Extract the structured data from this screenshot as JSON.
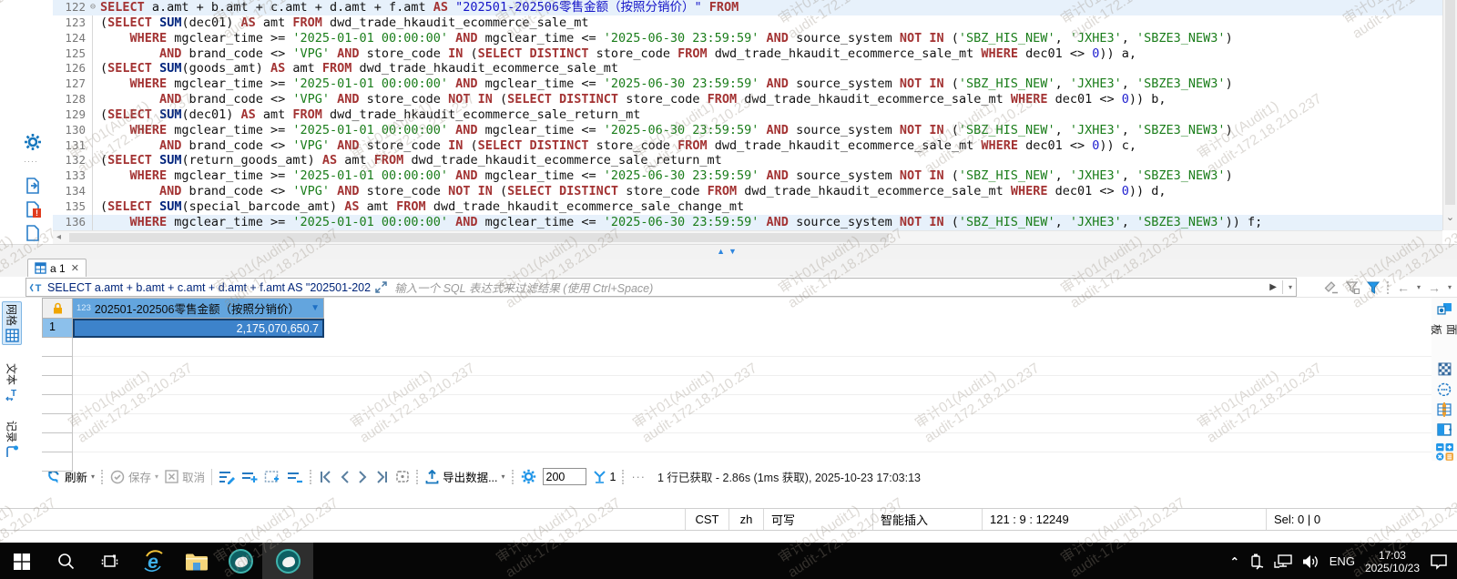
{
  "watermark": {
    "line1": "审计01(Audit1)",
    "line2": "audit-172.18.210.237"
  },
  "icons": {
    "caret_down": "▾",
    "close": "✕",
    "left_arrow": "◂",
    "down_arrow": "⌄",
    "sash_up": "▲",
    "sash_down": "▼",
    "fold_collapse": "⊖",
    "overflow": "···",
    "play": "▶",
    "back": "←",
    "forward": "→",
    "sort_down": "▼"
  },
  "editor": {
    "lines": [
      {
        "no": "122",
        "fold": "⊖",
        "hl": true,
        "t": [
          [
            "k",
            "SELECT"
          ],
          [
            "p",
            " a.amt + b.amt + c.amt + d.amt + f.amt "
          ],
          [
            "k",
            "AS"
          ],
          [
            "p",
            " "
          ],
          [
            "q",
            "\"202501-202506零售金额（按照分销价）\""
          ],
          [
            "p",
            " "
          ],
          [
            "k",
            "FROM"
          ]
        ]
      },
      {
        "no": "123",
        "scope": true,
        "t": [
          [
            "p",
            "("
          ],
          [
            "k",
            "SELECT"
          ],
          [
            "p",
            " "
          ],
          [
            "f",
            "SUM"
          ],
          [
            "p",
            "(dec01) "
          ],
          [
            "k",
            "AS"
          ],
          [
            "p",
            " amt "
          ],
          [
            "k",
            "FROM"
          ],
          [
            "p",
            " dwd_trade_hkaudit_ecommerce_sale_mt"
          ]
        ]
      },
      {
        "no": "124",
        "scope": true,
        "t": [
          [
            "p",
            "    "
          ],
          [
            "k",
            "WHERE"
          ],
          [
            "p",
            " mgclear_time >= "
          ],
          [
            "s",
            "'2025-01-01 00:00:00'"
          ],
          [
            "p",
            " "
          ],
          [
            "k",
            "AND"
          ],
          [
            "p",
            " mgclear_time <= "
          ],
          [
            "s",
            "'2025-06-30 23:59:59'"
          ],
          [
            "p",
            " "
          ],
          [
            "k",
            "AND"
          ],
          [
            "p",
            " source_system "
          ],
          [
            "k",
            "NOT IN"
          ],
          [
            "p",
            " ("
          ],
          [
            "s",
            "'SBZ_HIS_NEW'"
          ],
          [
            "p",
            ", "
          ],
          [
            "s",
            "'JXHE3'"
          ],
          [
            "p",
            ", "
          ],
          [
            "s",
            "'SBZE3_NEW3'"
          ],
          [
            "p",
            ")"
          ]
        ]
      },
      {
        "no": "125",
        "scope": true,
        "t": [
          [
            "p",
            "        "
          ],
          [
            "k",
            "AND"
          ],
          [
            "p",
            " brand_code <> "
          ],
          [
            "s",
            "'VPG'"
          ],
          [
            "p",
            " "
          ],
          [
            "k",
            "AND"
          ],
          [
            "p",
            " store_code "
          ],
          [
            "k",
            "IN"
          ],
          [
            "p",
            " ("
          ],
          [
            "k",
            "SELECT"
          ],
          [
            "p",
            " "
          ],
          [
            "k",
            "DISTINCT"
          ],
          [
            "p",
            " store_code "
          ],
          [
            "k",
            "FROM"
          ],
          [
            "p",
            " dwd_trade_hkaudit_ecommerce_sale_mt "
          ],
          [
            "k",
            "WHERE"
          ],
          [
            "p",
            " dec01 <> "
          ],
          [
            "n",
            "0"
          ],
          [
            "p",
            ")) a,"
          ]
        ]
      },
      {
        "no": "126",
        "scope": true,
        "t": [
          [
            "p",
            "("
          ],
          [
            "k",
            "SELECT"
          ],
          [
            "p",
            " "
          ],
          [
            "f",
            "SUM"
          ],
          [
            "p",
            "(goods_amt) "
          ],
          [
            "k",
            "AS"
          ],
          [
            "p",
            " amt "
          ],
          [
            "k",
            "FROM"
          ],
          [
            "p",
            " dwd_trade_hkaudit_ecommerce_sale_mt"
          ]
        ]
      },
      {
        "no": "127",
        "scope": true,
        "t": [
          [
            "p",
            "    "
          ],
          [
            "k",
            "WHERE"
          ],
          [
            "p",
            " mgclear_time >= "
          ],
          [
            "s",
            "'2025-01-01 00:00:00'"
          ],
          [
            "p",
            " "
          ],
          [
            "k",
            "AND"
          ],
          [
            "p",
            " mgclear_time <= "
          ],
          [
            "s",
            "'2025-06-30 23:59:59'"
          ],
          [
            "p",
            " "
          ],
          [
            "k",
            "AND"
          ],
          [
            "p",
            " source_system "
          ],
          [
            "k",
            "NOT IN"
          ],
          [
            "p",
            " ("
          ],
          [
            "s",
            "'SBZ_HIS_NEW'"
          ],
          [
            "p",
            ", "
          ],
          [
            "s",
            "'JXHE3'"
          ],
          [
            "p",
            ", "
          ],
          [
            "s",
            "'SBZE3_NEW3'"
          ],
          [
            "p",
            ")"
          ]
        ]
      },
      {
        "no": "128",
        "scope": true,
        "t": [
          [
            "p",
            "        "
          ],
          [
            "k",
            "AND"
          ],
          [
            "p",
            " brand_code <> "
          ],
          [
            "s",
            "'VPG'"
          ],
          [
            "p",
            " "
          ],
          [
            "k",
            "AND"
          ],
          [
            "p",
            " store_code "
          ],
          [
            "k",
            "NOT IN"
          ],
          [
            "p",
            " ("
          ],
          [
            "k",
            "SELECT"
          ],
          [
            "p",
            " "
          ],
          [
            "k",
            "DISTINCT"
          ],
          [
            "p",
            " store_code "
          ],
          [
            "k",
            "FROM"
          ],
          [
            "p",
            " dwd_trade_hkaudit_ecommerce_sale_mt "
          ],
          [
            "k",
            "WHERE"
          ],
          [
            "p",
            " dec01 <> "
          ],
          [
            "n",
            "0"
          ],
          [
            "p",
            ")) b,"
          ]
        ]
      },
      {
        "no": "129",
        "scope": true,
        "t": [
          [
            "p",
            "("
          ],
          [
            "k",
            "SELECT"
          ],
          [
            "p",
            " "
          ],
          [
            "f",
            "SUM"
          ],
          [
            "p",
            "(dec01) "
          ],
          [
            "k",
            "AS"
          ],
          [
            "p",
            " amt "
          ],
          [
            "k",
            "FROM"
          ],
          [
            "p",
            " dwd_trade_hkaudit_ecommerce_sale_return_mt"
          ]
        ]
      },
      {
        "no": "130",
        "scope": true,
        "t": [
          [
            "p",
            "    "
          ],
          [
            "k",
            "WHERE"
          ],
          [
            "p",
            " mgclear_time >= "
          ],
          [
            "s",
            "'2025-01-01 00:00:00'"
          ],
          [
            "p",
            " "
          ],
          [
            "k",
            "AND"
          ],
          [
            "p",
            " mgclear_time <= "
          ],
          [
            "s",
            "'2025-06-30 23:59:59'"
          ],
          [
            "p",
            " "
          ],
          [
            "k",
            "AND"
          ],
          [
            "p",
            " source_system "
          ],
          [
            "k",
            "NOT IN"
          ],
          [
            "p",
            " ("
          ],
          [
            "s",
            "'SBZ_HIS_NEW'"
          ],
          [
            "p",
            ", "
          ],
          [
            "s",
            "'JXHE3'"
          ],
          [
            "p",
            ", "
          ],
          [
            "s",
            "'SBZE3_NEW3'"
          ],
          [
            "p",
            ")"
          ]
        ]
      },
      {
        "no": "131",
        "scope": true,
        "t": [
          [
            "p",
            "        "
          ],
          [
            "k",
            "AND"
          ],
          [
            "p",
            " brand_code <> "
          ],
          [
            "s",
            "'VPG'"
          ],
          [
            "p",
            " "
          ],
          [
            "k",
            "AND"
          ],
          [
            "p",
            " store_code "
          ],
          [
            "k",
            "IN"
          ],
          [
            "p",
            " ("
          ],
          [
            "k",
            "SELECT"
          ],
          [
            "p",
            " "
          ],
          [
            "k",
            "DISTINCT"
          ],
          [
            "p",
            " store_code "
          ],
          [
            "k",
            "FROM"
          ],
          [
            "p",
            " dwd_trade_hkaudit_ecommerce_sale_mt "
          ],
          [
            "k",
            "WHERE"
          ],
          [
            "p",
            " dec01 <> "
          ],
          [
            "n",
            "0"
          ],
          [
            "p",
            ")) c,"
          ]
        ]
      },
      {
        "no": "132",
        "scope": true,
        "t": [
          [
            "p",
            "("
          ],
          [
            "k",
            "SELECT"
          ],
          [
            "p",
            " "
          ],
          [
            "f",
            "SUM"
          ],
          [
            "p",
            "(return_goods_amt) "
          ],
          [
            "k",
            "AS"
          ],
          [
            "p",
            " amt "
          ],
          [
            "k",
            "FROM"
          ],
          [
            "p",
            " dwd_trade_hkaudit_ecommerce_sale_return_mt"
          ]
        ]
      },
      {
        "no": "133",
        "scope": true,
        "t": [
          [
            "p",
            "    "
          ],
          [
            "k",
            "WHERE"
          ],
          [
            "p",
            " mgclear_time >= "
          ],
          [
            "s",
            "'2025-01-01 00:00:00'"
          ],
          [
            "p",
            " "
          ],
          [
            "k",
            "AND"
          ],
          [
            "p",
            " mgclear_time <= "
          ],
          [
            "s",
            "'2025-06-30 23:59:59'"
          ],
          [
            "p",
            " "
          ],
          [
            "k",
            "AND"
          ],
          [
            "p",
            " source_system "
          ],
          [
            "k",
            "NOT IN"
          ],
          [
            "p",
            " ("
          ],
          [
            "s",
            "'SBZ_HIS_NEW'"
          ],
          [
            "p",
            ", "
          ],
          [
            "s",
            "'JXHE3'"
          ],
          [
            "p",
            ", "
          ],
          [
            "s",
            "'SBZE3_NEW3'"
          ],
          [
            "p",
            ")"
          ]
        ]
      },
      {
        "no": "134",
        "scope": true,
        "t": [
          [
            "p",
            "        "
          ],
          [
            "k",
            "AND"
          ],
          [
            "p",
            " brand_code <> "
          ],
          [
            "s",
            "'VPG'"
          ],
          [
            "p",
            " "
          ],
          [
            "k",
            "AND"
          ],
          [
            "p",
            " store_code "
          ],
          [
            "k",
            "NOT IN"
          ],
          [
            "p",
            " ("
          ],
          [
            "k",
            "SELECT"
          ],
          [
            "p",
            " "
          ],
          [
            "k",
            "DISTINCT"
          ],
          [
            "p",
            " store_code "
          ],
          [
            "k",
            "FROM"
          ],
          [
            "p",
            " dwd_trade_hkaudit_ecommerce_sale_mt "
          ],
          [
            "k",
            "WHERE"
          ],
          [
            "p",
            " dec01 <> "
          ],
          [
            "n",
            "0"
          ],
          [
            "p",
            ")) d,"
          ]
        ]
      },
      {
        "no": "135",
        "scope": true,
        "t": [
          [
            "p",
            "("
          ],
          [
            "k",
            "SELECT"
          ],
          [
            "p",
            " "
          ],
          [
            "f",
            "SUM"
          ],
          [
            "p",
            "(special_barcode_amt) "
          ],
          [
            "k",
            "AS"
          ],
          [
            "p",
            " amt "
          ],
          [
            "k",
            "FROM"
          ],
          [
            "p",
            " dwd_trade_hkaudit_ecommerce_sale_change_mt"
          ]
        ]
      },
      {
        "no": "136",
        "scope": true,
        "hl": true,
        "t": [
          [
            "p",
            "    "
          ],
          [
            "k",
            "WHERE"
          ],
          [
            "p",
            " mgclear_time >= "
          ],
          [
            "s",
            "'2025-01-01 00:00:00'"
          ],
          [
            "p",
            " "
          ],
          [
            "k",
            "AND"
          ],
          [
            "p",
            " mgclear_time <= "
          ],
          [
            "s",
            "'2025-06-30 23:59:59'"
          ],
          [
            "p",
            " "
          ],
          [
            "k",
            "AND"
          ],
          [
            "p",
            " source_system "
          ],
          [
            "k",
            "NOT IN"
          ],
          [
            "p",
            " ("
          ],
          [
            "s",
            "'SBZ_HIS_NEW'"
          ],
          [
            "p",
            ", "
          ],
          [
            "s",
            "'JXHE3'"
          ],
          [
            "p",
            ", "
          ],
          [
            "s",
            "'SBZE3_NEW3'"
          ],
          [
            "p",
            ")) f;"
          ]
        ]
      }
    ]
  },
  "result_tab": {
    "label": "a 1"
  },
  "filter_bar": {
    "query": "SELECT a.amt + b.amt + c.amt + d.amt + f.amt AS \"202501-202",
    "placeholder": "输入一个 SQL 表达式来过滤结果 (使用 Ctrl+Space)"
  },
  "side_tabs": {
    "grid": "网格",
    "text": "文本",
    "record": "记录"
  },
  "right_panel": {
    "label": "面板"
  },
  "grid": {
    "type_badge": "123",
    "col_header": "202501-202506零售金额（按照分销价）",
    "row_no": "1",
    "value": "2,175,070,650.7"
  },
  "toolbar": {
    "refresh": "刷新",
    "save": "保存",
    "cancel": "取消",
    "export": "导出数据...",
    "fetch_size": "200",
    "fetch_page": "1",
    "status": "1 行已获取 - 2.86s (1ms 获取), 2025-10-23 17:03:13"
  },
  "status_bar": {
    "timezone": "CST",
    "lang": "zh",
    "writable": "可写",
    "insert_mode": "智能插入",
    "position": "121 : 9 : 12249",
    "selection": "Sel: 0 | 0"
  },
  "taskbar": {
    "lang": "ENG",
    "time": "17:03",
    "date": "2025/10/23"
  }
}
